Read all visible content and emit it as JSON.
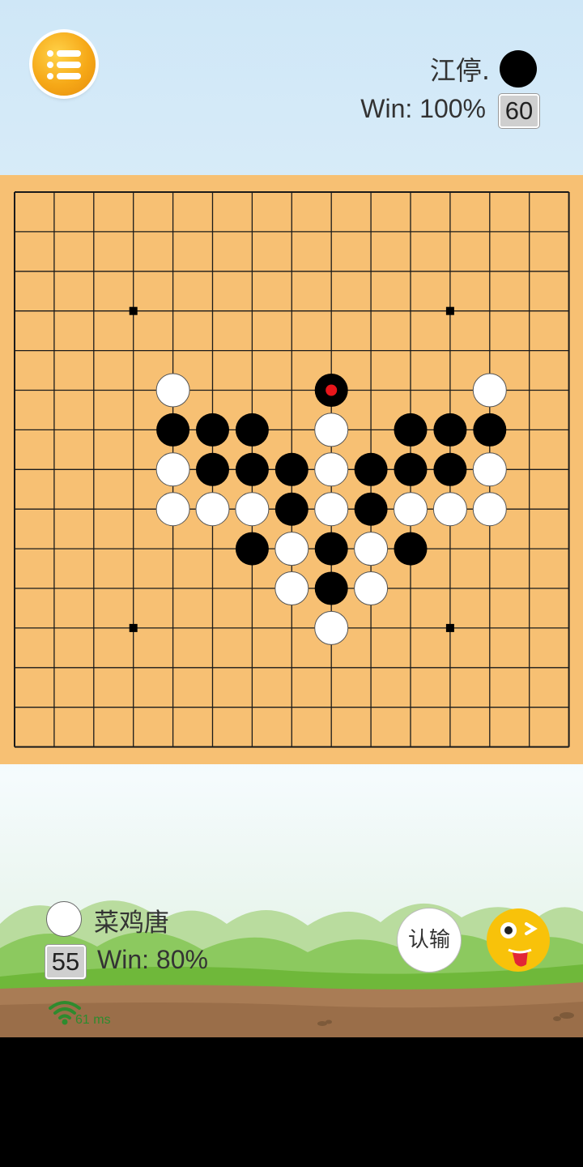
{
  "opponent": {
    "name": "江停.",
    "stone": "black",
    "win_text": "Win: 100%",
    "count": "60"
  },
  "me": {
    "name": "菜鸡唐",
    "stone": "white",
    "win_text": "Win: 80%",
    "count": "55"
  },
  "actions": {
    "resign_label": "认输",
    "menu_icon": "list-menu-icon",
    "emoji_icon": "winking-tongue-emoji-icon"
  },
  "network": {
    "latency_label": "61 ms"
  },
  "board": {
    "size": 15,
    "star_points": [
      [
        3,
        3
      ],
      [
        11,
        3
      ],
      [
        3,
        11
      ],
      [
        11,
        11
      ]
    ],
    "black": [
      [
        8,
        5
      ],
      [
        4,
        6
      ],
      [
        5,
        6
      ],
      [
        6,
        6
      ],
      [
        10,
        6
      ],
      [
        11,
        6
      ],
      [
        12,
        6
      ],
      [
        5,
        7
      ],
      [
        6,
        7
      ],
      [
        7,
        7
      ],
      [
        9,
        7
      ],
      [
        10,
        7
      ],
      [
        11,
        7
      ],
      [
        7,
        8
      ],
      [
        9,
        8
      ],
      [
        6,
        9
      ],
      [
        8,
        9
      ],
      [
        10,
        9
      ],
      [
        8,
        10
      ]
    ],
    "white": [
      [
        4,
        5
      ],
      [
        12,
        5
      ],
      [
        8,
        6
      ],
      [
        4,
        7
      ],
      [
        8,
        7
      ],
      [
        12,
        7
      ],
      [
        4,
        8
      ],
      [
        5,
        8
      ],
      [
        6,
        8
      ],
      [
        8,
        8
      ],
      [
        10,
        8
      ],
      [
        11,
        8
      ],
      [
        12,
        8
      ],
      [
        7,
        9
      ],
      [
        9,
        9
      ],
      [
        7,
        10
      ],
      [
        9,
        10
      ],
      [
        8,
        11
      ]
    ],
    "last_move": [
      8,
      5
    ]
  },
  "colors": {
    "board": "#f7c073",
    "last_move_marker": "#e8161b",
    "latency": "#2e8b2e"
  }
}
